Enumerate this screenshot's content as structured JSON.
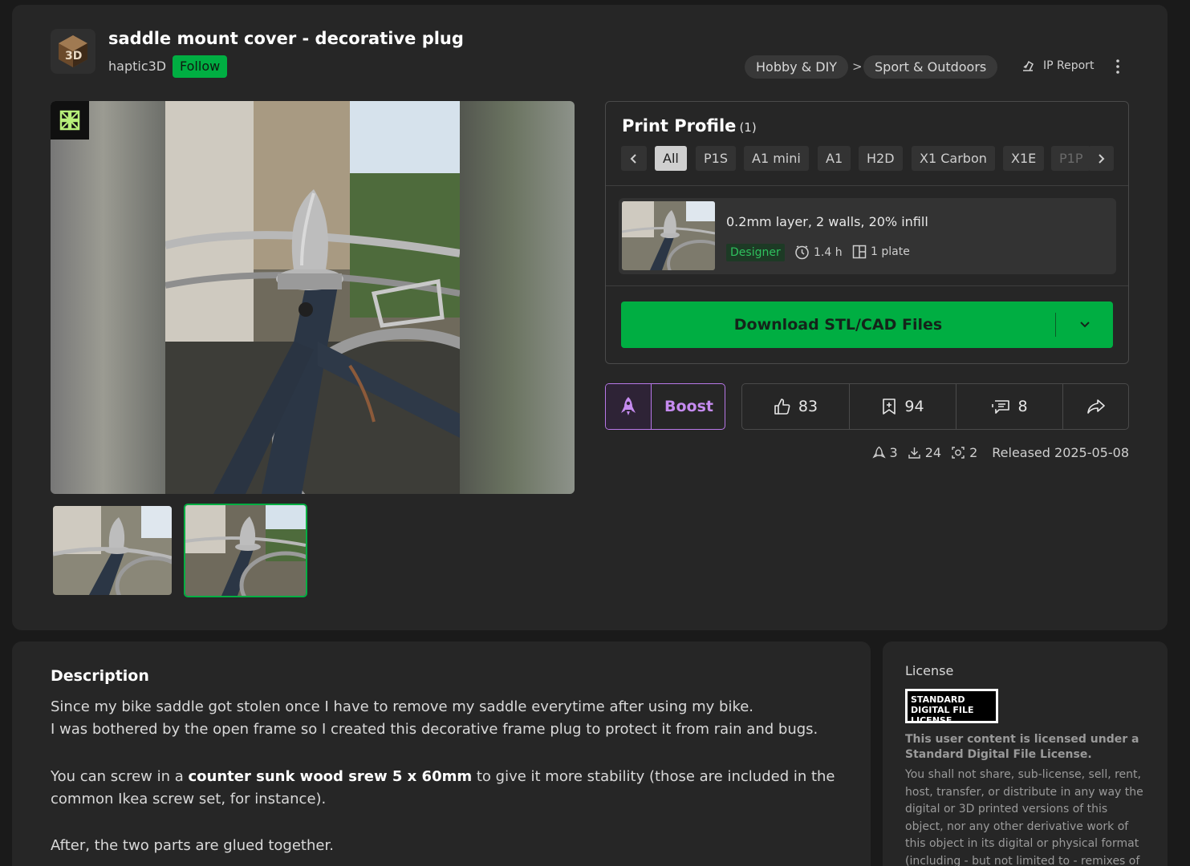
{
  "model": {
    "title": "saddle mount cover - decorative plug",
    "author": "haptic3D",
    "follow_label": "Follow"
  },
  "breadcrumb": {
    "category": "Hobby & DIY",
    "separator": ">",
    "subcategory": "Sport & Outdoors"
  },
  "header_actions": {
    "ip_report_label": "IP Report"
  },
  "print_profile": {
    "title": "Print Profile",
    "count": "(1)",
    "filters": [
      "All",
      "P1S",
      "A1 mini",
      "A1",
      "H2D",
      "X1 Carbon",
      "X1E",
      "P1P"
    ],
    "active_filter": "All",
    "profile": {
      "name": "0.2mm layer, 2 walls, 20% infill",
      "badge": "Designer",
      "time": "1.4 h",
      "plates": "1 plate"
    },
    "download_label": "Download STL/CAD Files"
  },
  "boost": {
    "label": "Boost"
  },
  "actions": {
    "likes": "83",
    "collects": "94",
    "comments": "8"
  },
  "stats": {
    "boosts": "3",
    "downloads": "24",
    "prints": "2",
    "released": "Released 2025-05-08"
  },
  "description": {
    "heading": "Description",
    "line1": "Since my bike saddle got stolen once I have to remove my saddle everytime after using my bike.",
    "line2": "I was bothered by the open frame so I created this decorative frame plug to protect it from rain and bugs.",
    "p2_before": "You can screw in a ",
    "p2_bold": "counter sunk wood srew 5 x 60mm",
    "p2_after": " to give it more stability (those are included in the common Ikea screw set, for instance).",
    "p3": "After, the two parts are glued together."
  },
  "license": {
    "heading": "License",
    "badge_text": "STANDARD DIGITAL FILE LICENSE",
    "bold_text": "This user content is licensed under a Standard Digital File License.",
    "body_text": "You shall not share, sub-license, sell, rent, host, transfer, or distribute in any way the digital or 3D printed versions of this object, nor any other derivative work of this object in its digital or physical format (including - but not limited to - remixes of this object,"
  },
  "colors": {
    "accent_green": "#00ae42",
    "boost_purple": "#c58bef",
    "background": "#1a1a1a",
    "card": "#262626"
  }
}
